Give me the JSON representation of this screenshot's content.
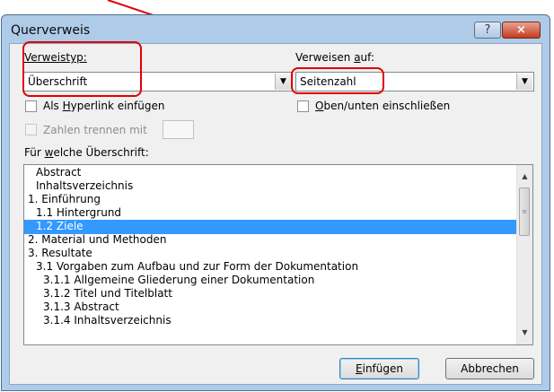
{
  "window": {
    "title": "Querverweis",
    "help_label": "?",
    "close_label": "×"
  },
  "verweistyp": {
    "label_prefix": "Verweistyp:",
    "value": "Überschrift"
  },
  "verweisen_auf": {
    "label_pre": "Verweisen ",
    "label_accel": "a",
    "label_post": "uf:",
    "value": "Seitenzahl"
  },
  "hyperlink": {
    "label_pre": "Als ",
    "label_accel": "H",
    "label_post": "yperlink einfügen",
    "checked": false
  },
  "oben_unten": {
    "label_accel": "O",
    "label_post": "ben/unten einschließen",
    "checked": false
  },
  "zahlen_trennen": {
    "label": "Zahlen trennen mit",
    "enabled": false,
    "value": ""
  },
  "list_label": {
    "pre": "Für ",
    "accel": "w",
    "post": "elche Überschrift:"
  },
  "headings": [
    {
      "text": "Abstract",
      "level": 1,
      "selected": false
    },
    {
      "text": "Inhaltsverzeichnis",
      "level": 1,
      "selected": false
    },
    {
      "text": "1. Einführung",
      "level": 0,
      "selected": false
    },
    {
      "text": "1.1 Hintergrund",
      "level": 1,
      "selected": false
    },
    {
      "text": "1.2 Ziele",
      "level": 1,
      "selected": true
    },
    {
      "text": "2. Material und Methoden",
      "level": 0,
      "selected": false
    },
    {
      "text": "3. Resultate",
      "level": 0,
      "selected": false
    },
    {
      "text": "3.1 Vorgaben zum Aufbau und zur Form der Dokumentation",
      "level": 1,
      "selected": false
    },
    {
      "text": "3.1.1 Allgemeine Gliederung einer Dokumentation",
      "level": 2,
      "selected": false
    },
    {
      "text": "3.1.2 Titel und Titelblatt",
      "level": 2,
      "selected": false
    },
    {
      "text": "3.1.3 Abstract",
      "level": 2,
      "selected": false
    },
    {
      "text": "3.1.4 Inhaltsverzeichnis",
      "level": 2,
      "selected": false
    }
  ],
  "buttons": {
    "insert_accel": "E",
    "insert_post": "infügen",
    "cancel": "Abbrechen"
  },
  "colors": {
    "highlight": "#e00000",
    "selection": "#3399ff"
  }
}
